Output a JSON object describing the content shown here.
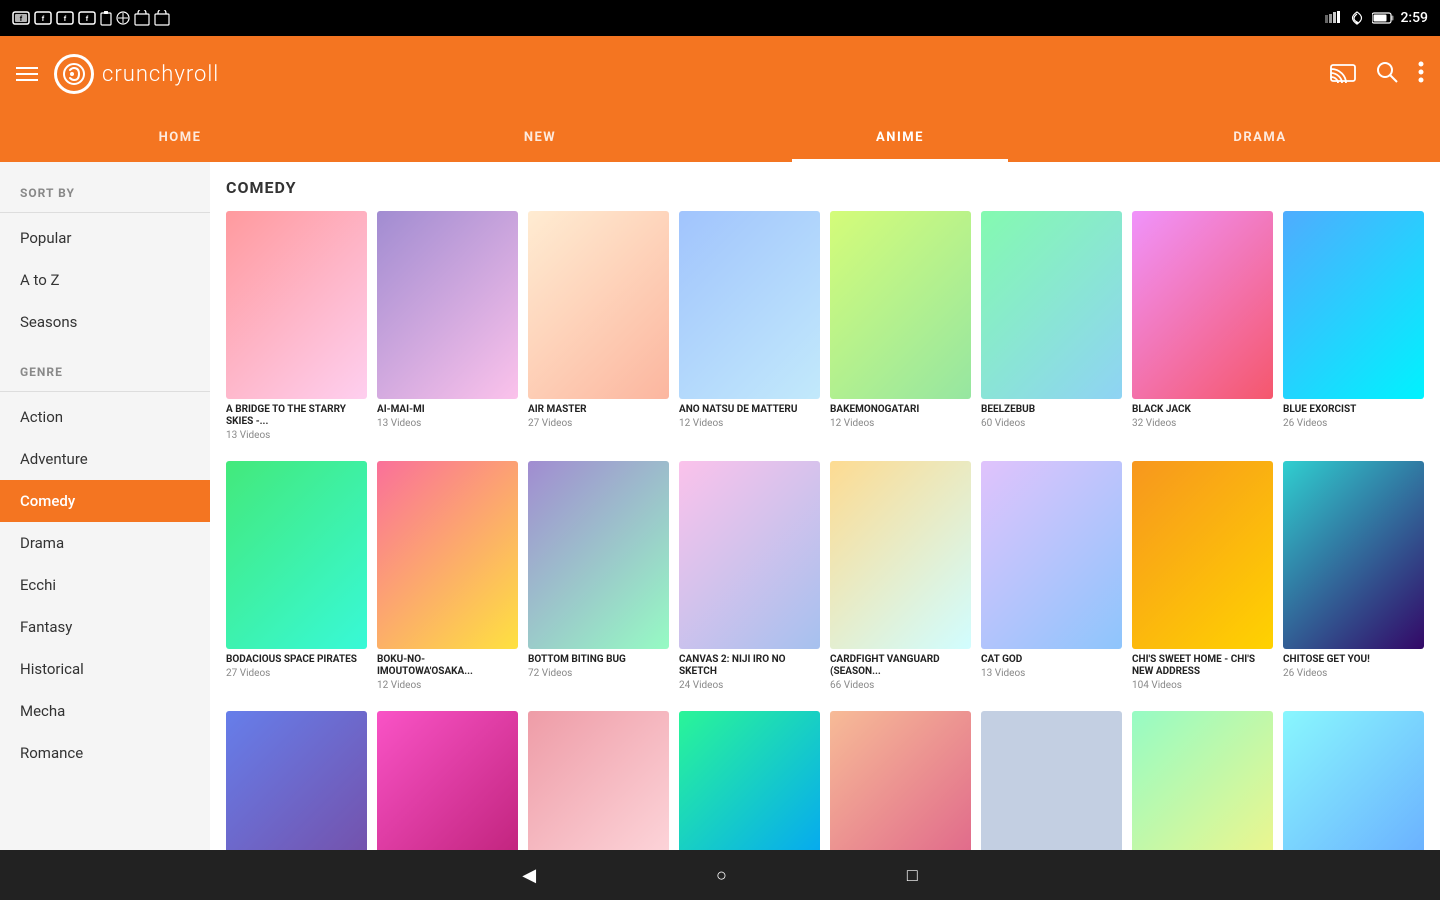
{
  "statusBar": {
    "time": "2:59",
    "icons": [
      "fb",
      "fb",
      "fb",
      "fb",
      "phone",
      "bug",
      "cart",
      "cart2"
    ]
  },
  "header": {
    "logoText": "crunchyroll",
    "menuIcon": "☰",
    "castLabel": "cast-icon",
    "searchLabel": "search-icon",
    "moreLabel": "more-icon"
  },
  "navTabs": [
    {
      "id": "home",
      "label": "HOME"
    },
    {
      "id": "new",
      "label": "NEW"
    },
    {
      "id": "anime",
      "label": "ANIME",
      "active": true
    },
    {
      "id": "drama",
      "label": "DRAMA"
    }
  ],
  "sidebar": {
    "sortByLabel": "SORT BY",
    "sortItems": [
      {
        "id": "popular",
        "label": "Popular"
      },
      {
        "id": "a-to-z",
        "label": "A to Z"
      },
      {
        "id": "seasons",
        "label": "Seasons"
      }
    ],
    "genreLabel": "GENRE",
    "genreItems": [
      {
        "id": "action",
        "label": "Action"
      },
      {
        "id": "adventure",
        "label": "Adventure"
      },
      {
        "id": "comedy",
        "label": "Comedy",
        "active": true
      },
      {
        "id": "drama",
        "label": "Drama"
      },
      {
        "id": "ecchi",
        "label": "Ecchi"
      },
      {
        "id": "fantasy",
        "label": "Fantasy"
      },
      {
        "id": "historical",
        "label": "Historical"
      },
      {
        "id": "mecha",
        "label": "Mecha"
      },
      {
        "id": "romance",
        "label": "Romance"
      }
    ]
  },
  "comedy": {
    "sectionTitle": "COMEDY",
    "row1": [
      {
        "title": "A BRIDGE TO THE STARRY SKIES -...",
        "videos": "13 Videos",
        "thumb": "thumb-1"
      },
      {
        "title": "AI-MAI-MI",
        "videos": "13 Videos",
        "thumb": "thumb-2"
      },
      {
        "title": "AIR MASTER",
        "videos": "27 Videos",
        "thumb": "thumb-3"
      },
      {
        "title": "ANO NATSU DE MATTERU",
        "videos": "12 Videos",
        "thumb": "thumb-4"
      },
      {
        "title": "BAKEMONOGATARI",
        "videos": "12 Videos",
        "thumb": "thumb-5"
      },
      {
        "title": "BEELZEBUB",
        "videos": "60 Videos",
        "thumb": "thumb-6"
      },
      {
        "title": "BLACK JACK",
        "videos": "32 Videos",
        "thumb": "thumb-7"
      },
      {
        "title": "BLUE EXORCIST",
        "videos": "26 Videos",
        "thumb": "thumb-8"
      }
    ],
    "row2": [
      {
        "title": "BODACIOUS SPACE PIRATES",
        "videos": "27 Videos",
        "thumb": "thumb-9"
      },
      {
        "title": "BOKU-NO-IMOUTOWA'OSAKA...",
        "videos": "12 Videos",
        "thumb": "thumb-10"
      },
      {
        "title": "BOTTOM BITING BUG",
        "videos": "72 Videos",
        "thumb": "thumb-11"
      },
      {
        "title": "CANVAS 2: NIJI IRO NO SKETCH",
        "videos": "24 Videos",
        "thumb": "thumb-12"
      },
      {
        "title": "CARDFIGHT VANGUARD (SEASON...",
        "videos": "66 Videos",
        "thumb": "thumb-13"
      },
      {
        "title": "CAT GOD",
        "videos": "13 Videos",
        "thumb": "thumb-14"
      },
      {
        "title": "CHI'S SWEET HOME - CHI'S NEW ADDRESS",
        "videos": "104 Videos",
        "thumb": "thumb-15"
      },
      {
        "title": "CHITOSE GET YOU!",
        "videos": "26 Videos",
        "thumb": "thumb-16"
      }
    ],
    "row3": [
      {
        "title": "",
        "videos": "",
        "thumb": "thumb-17"
      },
      {
        "title": "",
        "videos": "",
        "thumb": "thumb-18"
      },
      {
        "title": "",
        "videos": "",
        "thumb": "thumb-19"
      },
      {
        "title": "",
        "videos": "",
        "thumb": "thumb-20"
      },
      {
        "title": "",
        "videos": "",
        "thumb": "thumb-21"
      },
      {
        "title": "",
        "videos": "",
        "thumb": "thumb-22"
      },
      {
        "title": "",
        "videos": "",
        "thumb": "thumb-23"
      },
      {
        "title": "",
        "videos": "",
        "thumb": "thumb-24"
      }
    ]
  },
  "bottomNav": {
    "backIcon": "◀",
    "homeIcon": "○",
    "recentIcon": "□"
  }
}
